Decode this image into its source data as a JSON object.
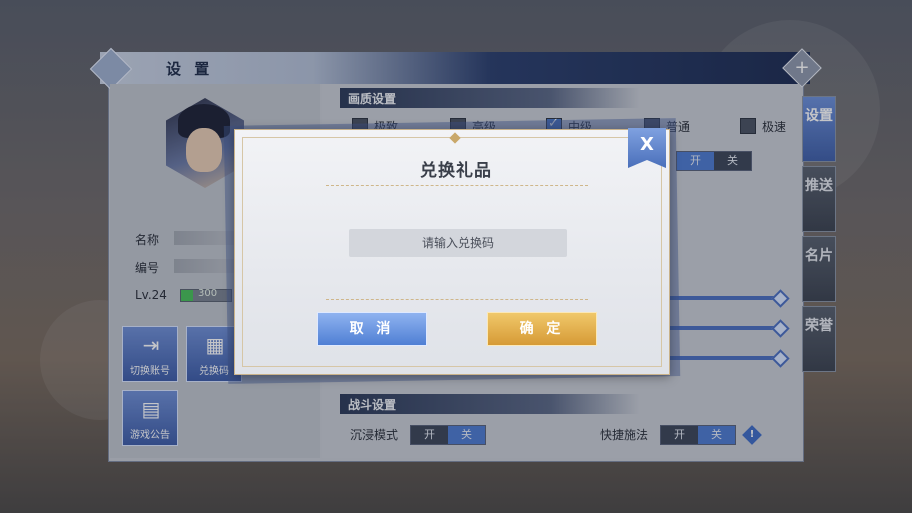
{
  "window": {
    "title": "设 置"
  },
  "profile": {
    "name_label": "名称",
    "id_label": "编号",
    "level": "Lv.24",
    "exp_value": "300"
  },
  "actions": [
    {
      "label": "切换账号",
      "icon": "logout-icon"
    },
    {
      "label": "兑换码",
      "icon": "gift-icon"
    },
    {
      "label": "游戏公告",
      "icon": "notice-board-icon"
    }
  ],
  "graphics": {
    "section": "画质设置",
    "options": [
      {
        "label": "极致",
        "checked": false
      },
      {
        "label": "高级",
        "checked": false
      },
      {
        "label": "中级",
        "checked": true
      },
      {
        "label": "普通",
        "checked": false
      },
      {
        "label": "极速",
        "checked": false
      }
    ],
    "toggle": {
      "on": "开",
      "off": "关",
      "state": "on"
    }
  },
  "combat": {
    "section": "战斗设置",
    "immersive": {
      "label": "沉浸模式",
      "on": "开",
      "off": "关",
      "state": "off"
    },
    "quick_cast": {
      "label": "快捷施法",
      "on": "开",
      "off": "关",
      "state": "off"
    },
    "info_icon": "!"
  },
  "side_tabs": [
    {
      "label": "设置",
      "active": true
    },
    {
      "label": "推送",
      "active": false
    },
    {
      "label": "名片",
      "active": false
    },
    {
      "label": "荣誉",
      "active": false
    }
  ],
  "dialog": {
    "title": "兑换礼品",
    "input_placeholder": "请输入兑换码",
    "input_value": "",
    "cancel_label": "取 消",
    "confirm_label": "确 定",
    "close_icon": "X"
  },
  "colors": {
    "accent_blue": "#4e7bd0",
    "confirm_gold": "#d69a36",
    "panel_bg": "#c9cdd5"
  }
}
